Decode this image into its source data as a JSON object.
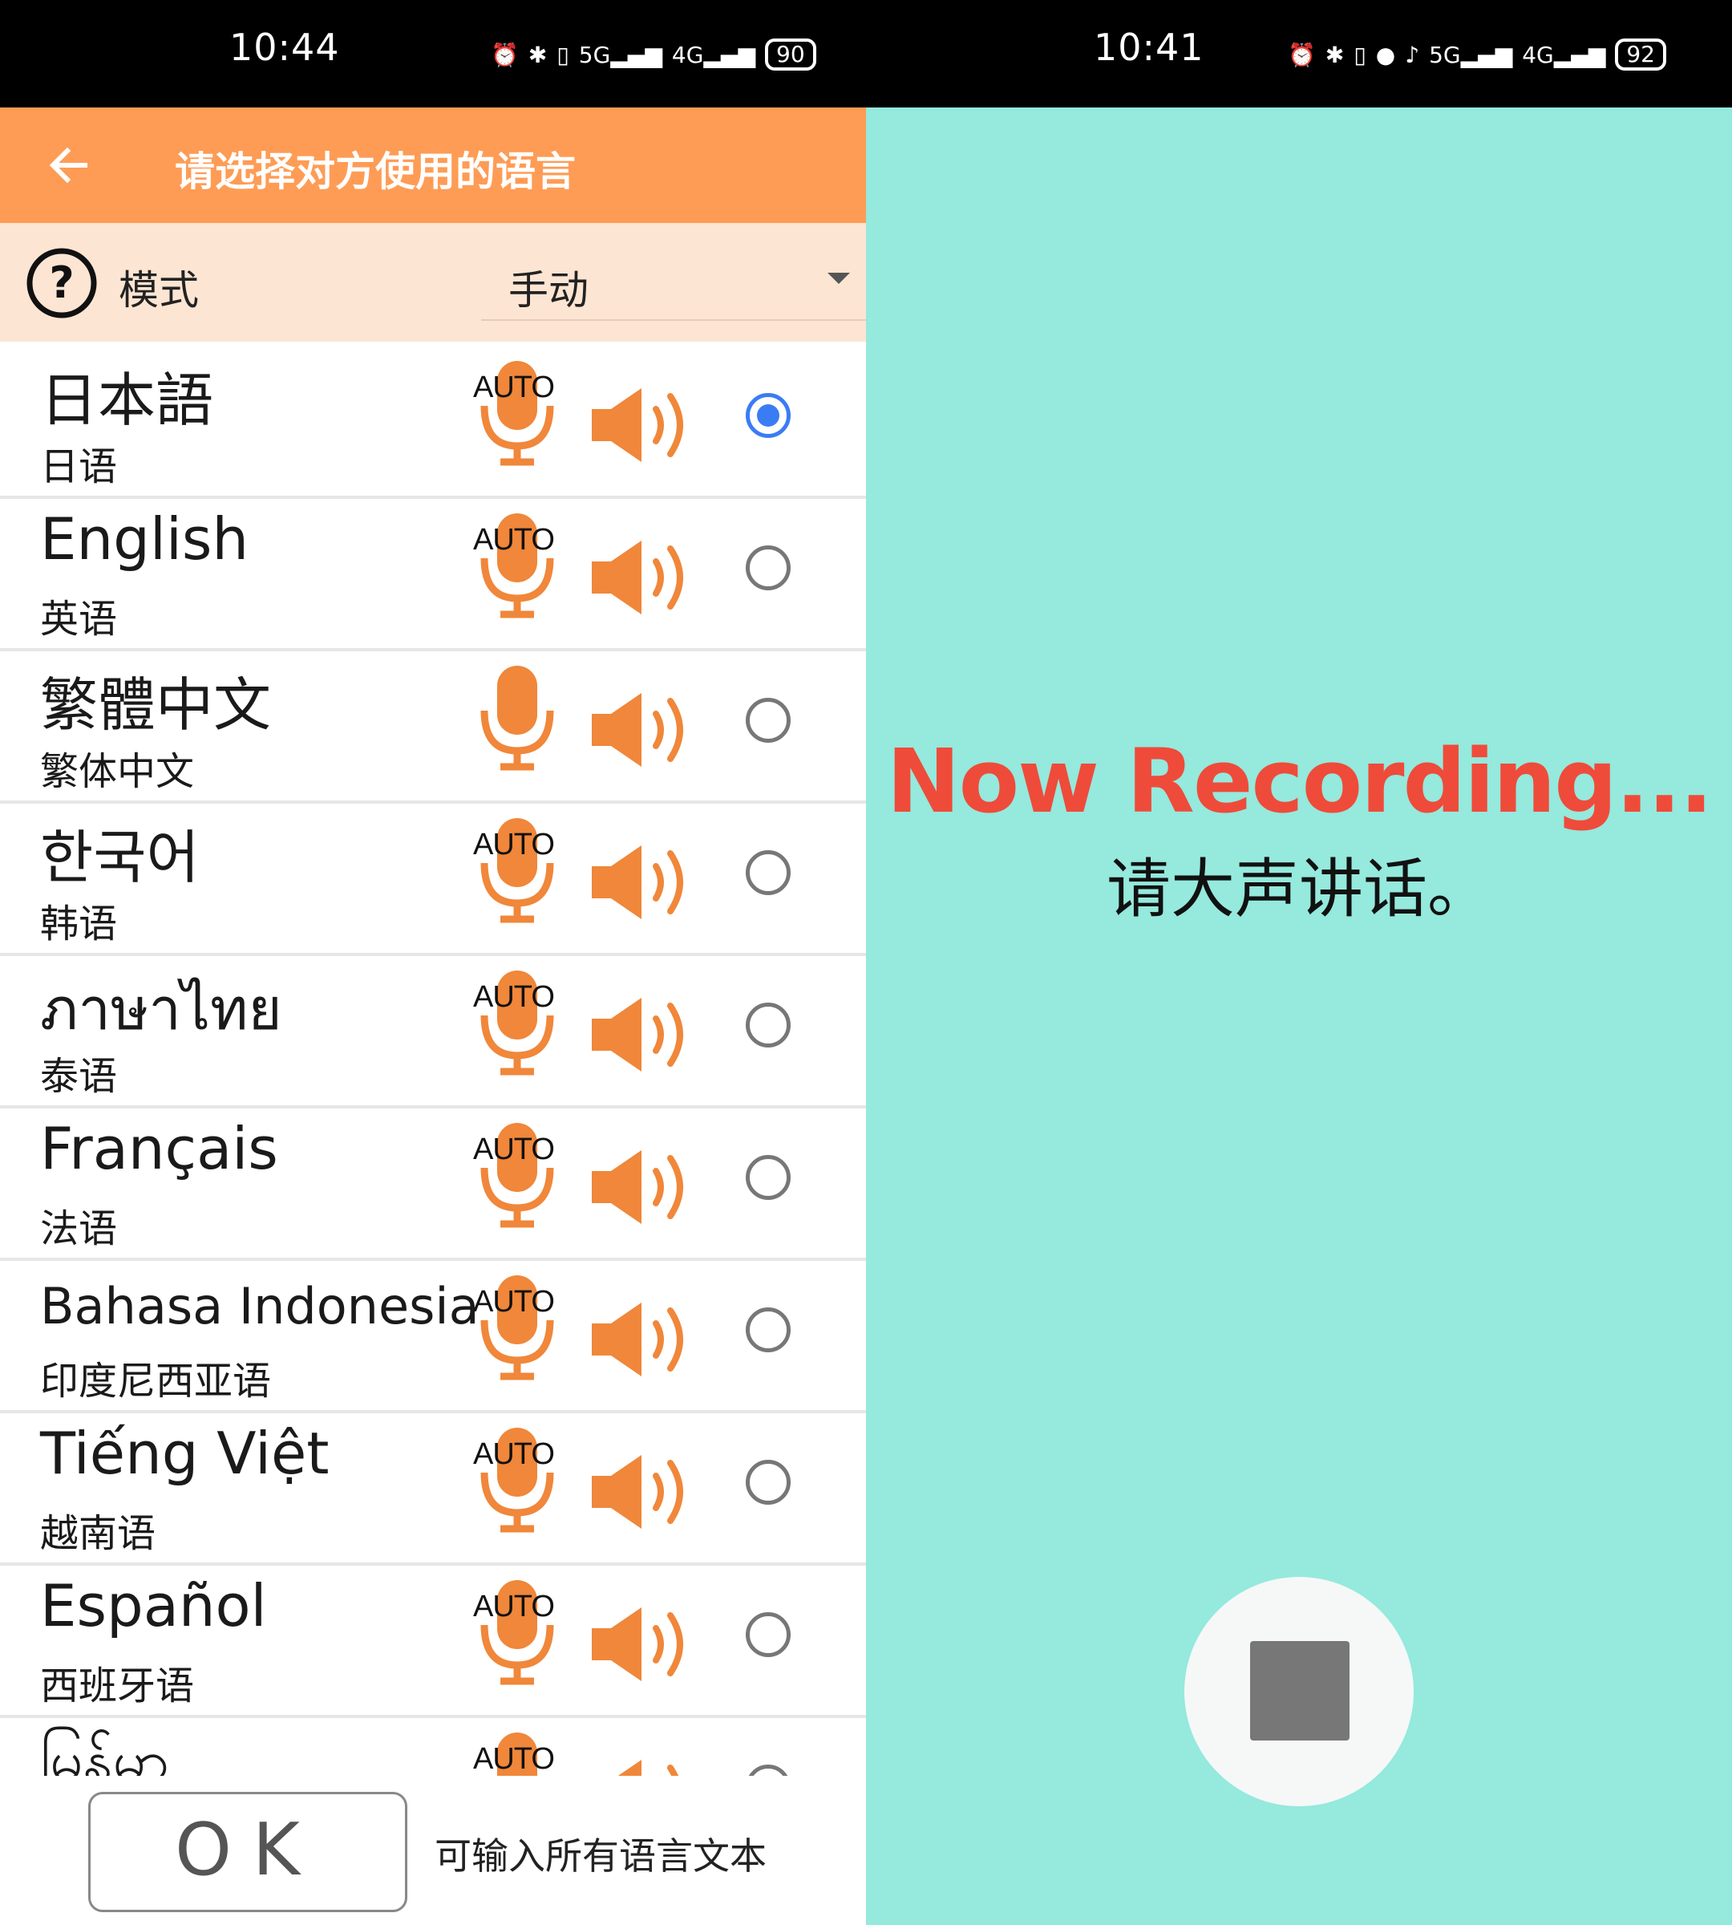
{
  "left_screen": {
    "status_bar": {
      "time": "10:44",
      "icons": [
        "alarm-icon",
        "bluetooth-icon",
        "vibrate-icon",
        "5g-signal-icon",
        "4g-signal-icon",
        "battery-icon"
      ],
      "battery": "90"
    },
    "app_bar": {
      "title": "请选择对方使用的语言"
    },
    "mode": {
      "label": "模式",
      "value": "手动"
    },
    "languages": [
      {
        "name": "日本語",
        "sub": "日语",
        "auto": "AUTO",
        "selected": true
      },
      {
        "name": "English",
        "sub": "英语",
        "auto": "AUTO",
        "selected": false
      },
      {
        "name": "繁體中文",
        "sub": "繁体中文",
        "auto": "",
        "selected": false
      },
      {
        "name": "한국어",
        "sub": "韩语",
        "auto": "AUTO",
        "selected": false
      },
      {
        "name": "ภาษาไทย",
        "sub": "泰语",
        "auto": "AUTO",
        "selected": false
      },
      {
        "name": "Français",
        "sub": "法语",
        "auto": "AUTO",
        "selected": false
      },
      {
        "name": "Bahasa Indonesia",
        "sub": "印度尼西亚语",
        "auto": "AUTO",
        "selected": false
      },
      {
        "name": "Tiếng Việt",
        "sub": "越南语",
        "auto": "AUTO",
        "selected": false
      },
      {
        "name": "Español",
        "sub": "西班牙语",
        "auto": "AUTO",
        "selected": false
      },
      {
        "name": "မြန်မာ",
        "sub": "",
        "auto": "AUTO",
        "selected": false
      }
    ],
    "ok_button": "OK",
    "hint": "可输入所有语言文本"
  },
  "right_screen": {
    "status_bar": {
      "time": "10:41",
      "icons": [
        "alarm-icon",
        "bluetooth-icon",
        "vibrate-icon",
        "location-icon",
        "mic-icon",
        "5g-signal-icon",
        "4g-signal-icon",
        "battery-icon"
      ],
      "battery": "92"
    },
    "recording_title": "Now Recording...",
    "recording_hint": "请大声讲话。"
  },
  "colors": {
    "app_bar": "#fe9c55",
    "mode_row": "#fde5d3",
    "icon_orange": "#f0873a",
    "radio_selected": "#3a7cf4",
    "recording_bg": "#95e9dd",
    "recording_text": "#ef4b3a"
  }
}
